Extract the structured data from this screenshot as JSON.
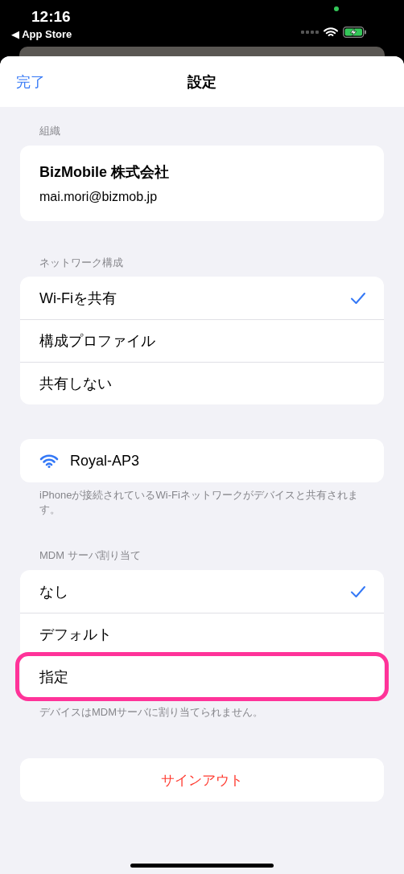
{
  "status_bar": {
    "time": "12:16",
    "back_label": "◀ App Store"
  },
  "nav": {
    "done": "完了",
    "title": "設定"
  },
  "organization": {
    "header": "組織",
    "name": "BizMobile 株式会社",
    "email": "mai.mori@bizmob.jp"
  },
  "network": {
    "header": "ネットワーク構成",
    "options": [
      {
        "label": "Wi-Fiを共有",
        "selected": true,
        "highlighted": false
      },
      {
        "label": "構成プロファイル",
        "selected": false,
        "highlighted": false
      },
      {
        "label": "共有しない",
        "selected": false,
        "highlighted": false
      }
    ]
  },
  "wifi": {
    "ssid": "Royal-AP3",
    "footer": "iPhoneが接続されているWi-Fiネットワークがデバイスと共有されます。"
  },
  "mdm": {
    "header": "MDM サーバ割り当て",
    "options": [
      {
        "label": "なし",
        "selected": true,
        "highlighted": false
      },
      {
        "label": "デフォルト",
        "selected": false,
        "highlighted": false
      },
      {
        "label": "指定",
        "selected": false,
        "highlighted": true
      }
    ],
    "footer": "デバイスはMDMサーバに割り当てられません。"
  },
  "sign_out": "サインアウト"
}
